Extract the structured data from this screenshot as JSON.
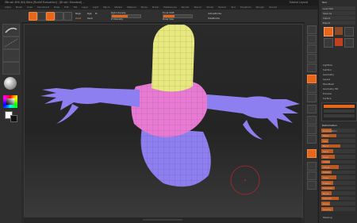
{
  "app": {
    "title": "ZBrush 4R6 (64) Beta [RLsfdf Evaluation] : [Brush: Standard] ...",
    "status_right": "Tutorial Layout"
  },
  "menu": [
    "Alpha",
    "Brush",
    "Color",
    "Document",
    "Draw",
    "Edit",
    "File",
    "Layer",
    "Light",
    "Macro",
    "Marker",
    "Material",
    "Movie",
    "Picker",
    "Preferences",
    "Render",
    "Stencil",
    "Stroke",
    "Texture",
    "Tool",
    "Transform",
    "Zplugin",
    "Zscript"
  ],
  "toolbar": {
    "buttons": [
      "Edit",
      "Draw",
      "Move",
      "Scale",
      "Rotate"
    ],
    "mrgb": "Mrgb",
    "rgb": "Rgb",
    "m": "M",
    "zadd": "Zadd",
    "zsub": "Zsub",
    "rgb_intensity": "Rgb Intensity",
    "z_intensity": "Z Intensity",
    "focal_shift": "Focal Shift",
    "draw_size": "Draw Size",
    "active_points": "ActivePoints",
    "total_points": "TotalPoints"
  },
  "left_shelf": {
    "brush_label": "Projection Master",
    "lightbox": "LightBox",
    "quick_sketch": "Quick Sketch"
  },
  "right_tray": {
    "header": "Tool",
    "items": [
      "Load Tool",
      "Save As",
      "Import",
      "Export",
      "Clone",
      "Make PolyMesh3D",
      "GoZ",
      "All",
      "Visible",
      "R"
    ],
    "sections": [
      "Lightbox",
      "SubTool",
      "Geometry",
      "Layers",
      "FiberMesh",
      "Geometry HD",
      "Preview",
      "Surface"
    ],
    "subtool_items": [
      "Shadow",
      "Layers",
      "FiberMesh",
      "Geometry HD",
      "Preview",
      "Surface"
    ],
    "deformation_header": "Deformation",
    "deformation_items": [
      "Deformation",
      "Relax",
      "Size",
      "Bend",
      "Twist",
      "Taper",
      "Inflate",
      "Offset",
      "Rotate",
      "Skew",
      "Flatten",
      "Squeeze",
      "Noise",
      "Smooth",
      "Polish",
      "Gravity"
    ],
    "footer": "Masking"
  },
  "colors": {
    "accent": "#e8661a",
    "bg": "#2a2a2a",
    "yellow": "#e7e97f",
    "pink": "#e87ad3",
    "purple": "#8d7ff0"
  }
}
